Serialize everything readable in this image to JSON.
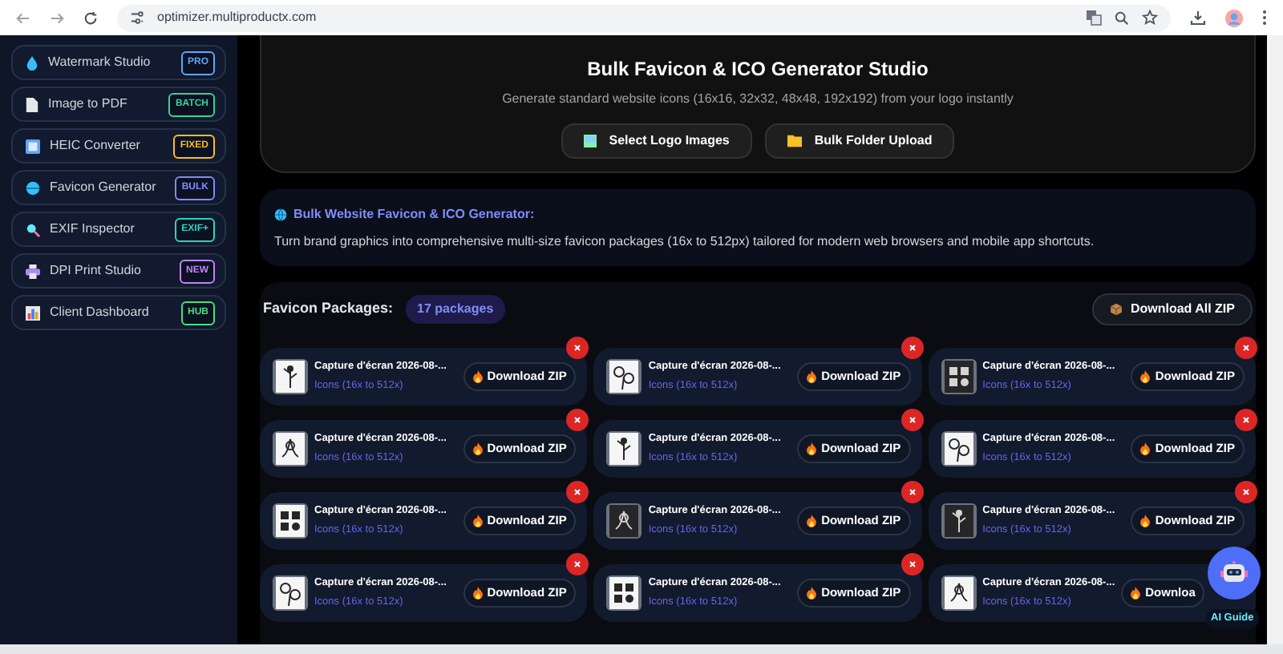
{
  "browser": {
    "url": "optimizer.multiproductx.com"
  },
  "sidebar": {
    "items": [
      {
        "label": "Watermark Studio",
        "badge": "PRO",
        "color": "#60a5fa"
      },
      {
        "label": "Image to PDF",
        "badge": "BATCH",
        "color": "#34d399"
      },
      {
        "label": "HEIC Converter",
        "badge": "FIXED",
        "color": "#fbbf24"
      },
      {
        "label": "Favicon Generator",
        "badge": "BULK",
        "color": "#818cf8"
      },
      {
        "label": "EXIF Inspector",
        "badge": "EXIF+",
        "color": "#2dd4bf"
      },
      {
        "label": "DPI Print Studio",
        "badge": "NEW",
        "color": "#c084fc"
      },
      {
        "label": "Client Dashboard",
        "badge": "HUB",
        "color": "#4ade80"
      }
    ]
  },
  "hero": {
    "title": "Bulk Favicon & ICO Generator Studio",
    "subtitle": "Generate standard website icons (16x16, 32x32, 48x48, 192x192) from your logo instantly",
    "buttons": [
      "Select Logo Images",
      "Bulk Folder Upload"
    ]
  },
  "info": {
    "title": "Bulk Website Favicon & ICO Generator:",
    "text": "Turn brand graphics into comprehensive multi-size favicon packages (16x to 512px) tailored for modern web browsers and mobile app shortcuts."
  },
  "packages": {
    "label": "Favicon Packages:",
    "count": "17 packages",
    "download_all": "Download All ZIP",
    "items": [
      {
        "name": "Capture d'écran 2026-08-...",
        "sizes": "Icons (16x to 512x)",
        "button": "Download ZIP"
      },
      {
        "name": "Capture d'écran 2026-08-...",
        "sizes": "Icons (16x to 512x)",
        "button": "Download ZIP"
      },
      {
        "name": "Capture d'écran 2026-08-...",
        "sizes": "Icons (16x to 512x)",
        "button": "Download ZIP"
      },
      {
        "name": "Capture d'écran 2026-08-...",
        "sizes": "Icons (16x to 512x)",
        "button": "Download ZIP"
      },
      {
        "name": "Capture d'écran 2026-08-...",
        "sizes": "Icons (16x to 512x)",
        "button": "Download ZIP"
      },
      {
        "name": "Capture d'écran 2026-08-...",
        "sizes": "Icons (16x to 512x)",
        "button": "Download ZIP"
      },
      {
        "name": "Capture d'écran 2026-08-...",
        "sizes": "Icons (16x to 512x)",
        "button": "Download ZIP"
      },
      {
        "name": "Capture d'écran 2026-08-...",
        "sizes": "Icons (16x to 512x)",
        "button": "Download ZIP"
      },
      {
        "name": "Capture d'écran 2026-08-...",
        "sizes": "Icons (16x to 512x)",
        "button": "Download ZIP"
      },
      {
        "name": "Capture d'écran 2026-08-...",
        "sizes": "Icons (16x to 512x)",
        "button": "Download ZIP"
      },
      {
        "name": "Capture d'écran 2026-08-...",
        "sizes": "Icons (16x to 512x)",
        "button": "Download ZIP"
      },
      {
        "name": "Capture d'écran 2026-08-...",
        "sizes": "Icons (16x to 512x)",
        "button": "Downloa",
        "covered": true
      }
    ]
  },
  "assistant": {
    "label": "AI Guide"
  }
}
